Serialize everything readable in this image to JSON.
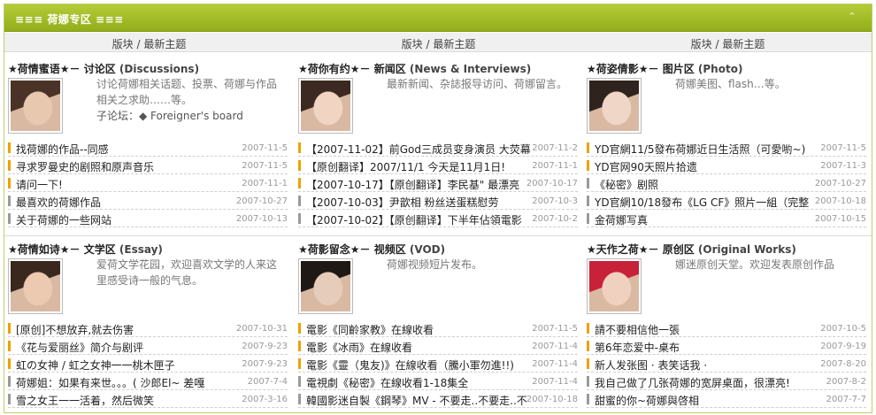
{
  "header": {
    "title": "≡≡≡ 荷娜专区 ≡≡≡",
    "collapse_icon": "chevron-up-icon",
    "collapse_glyph": "⌃"
  },
  "columns": [
    {
      "label": "版块  / 最新主题"
    },
    {
      "label": "版块  / 最新主题"
    },
    {
      "label": "版块  / 最新主题"
    }
  ],
  "forums": [
    {
      "title": "★荷情蜜语★－ 讨论区",
      "title_en": "(Discussions)",
      "desc": "讨论荷娜相关话题、投票、荷娜与作品相关之求助……等。",
      "sub_label": "子论坛：",
      "sub_item": "◆ Foreigner's board",
      "photo_colors": [
        "#e9c8b0",
        "#4a3326"
      ],
      "topics": [
        {
          "title": "找荷娜的作品--同感",
          "date": "2007-11-5",
          "gray": false
        },
        {
          "title": "寻求罗曼史的剧照和原声音乐",
          "date": "2007-11-5",
          "gray": false
        },
        {
          "title": "请问一下!",
          "date": "2007-11-1",
          "gray": false
        },
        {
          "title": "最喜欢的荷娜作品",
          "date": "2007-10-27",
          "gray": true
        },
        {
          "title": "关于荷娜的一些网站",
          "date": "2007-10-13",
          "gray": true
        }
      ]
    },
    {
      "title": "★荷你有约★－ 新闻区",
      "title_en": "(News & Interviews)",
      "desc": "最新新闻、杂誌报导访问、荷娜留言。",
      "sub_label": "",
      "sub_item": "",
      "photo_colors": [
        "#f1d4c2",
        "#3c2a22"
      ],
      "topics": [
        {
          "title": "【2007-11-02】前God三成员变身演员  大荧幕",
          "date": "2007-11-2",
          "gray": false
        },
        {
          "title": "【原创翻译】2007/11/1 今天是11月1日!",
          "date": "2007-11-1",
          "gray": false
        },
        {
          "title": "【2007-10-17】【原创翻译】李民基\" 最漂亮",
          "date": "2007-10-17",
          "gray": false
        },
        {
          "title": "【2007-10-03】尹歆相  粉丝送蛋糕慰劳",
          "date": "2007-10-3",
          "gray": true
        },
        {
          "title": "【2007-10-02】【原创翻译】下半年佔領電影",
          "date": "2007-10-2",
          "gray": true
        }
      ]
    },
    {
      "title": "★荷姿倩影★－ 图片区",
      "title_en": "(Photo)",
      "desc": "荷娜美图、flash…等。",
      "sub_label": "",
      "sub_item": "",
      "photo_colors": [
        "#efd6c6",
        "#2f231e"
      ],
      "topics": [
        {
          "title": "YD官網11/5發布荷娜近日生活照（可愛喲~)",
          "date": "2007-11-5",
          "gray": false
        },
        {
          "title": "YD官网90天照片拾遗",
          "date": "2007-11-3",
          "gray": false
        },
        {
          "title": "《秘密》剧照",
          "date": "2007-10-27",
          "gray": true
        },
        {
          "title": "YD官網10/18發布《LG CF》照片一組（完整",
          "date": "2007-10-18",
          "gray": true
        },
        {
          "title": "金荷娜写真",
          "date": "2007-10-15",
          "gray": true
        }
      ]
    },
    {
      "title": "★荷情如诗★－ 文学区",
      "title_en": "(Essay)",
      "desc": "爱荷文学花园，欢迎喜欢文学的人来这里感受诗一般的气息。",
      "sub_label": "",
      "sub_item": "",
      "photo_colors": [
        "#ecc9b1",
        "#3a271d"
      ],
      "topics": [
        {
          "title": "[原创]不想放弃,就去伤害",
          "date": "2007-10-31",
          "gray": false
        },
        {
          "title": "《花与爱丽丝》简介与剧评",
          "date": "2007-9-23",
          "gray": false
        },
        {
          "title": "虹の女神 / 虹之女神一一桃木匣子",
          "date": "2007-9-23",
          "gray": false
        },
        {
          "title": "荷娜姐：如果有来世。。。( 沙郎El~ 差嘎",
          "date": "2007-7-4",
          "gray": true
        },
        {
          "title": "雪之女王一一活着，然后微笑",
          "date": "2007-3-16",
          "gray": true
        }
      ]
    },
    {
      "title": "★荷影留念★－ 视频区",
      "title_en": "(VOD)",
      "desc": "荷娜视频短片发布。",
      "sub_label": "",
      "sub_item": "",
      "photo_colors": [
        "#e6ccba",
        "#1f1916"
      ],
      "topics": [
        {
          "title": "電影《同齡家教》在線收看",
          "date": "2007-11-5",
          "gray": false
        },
        {
          "title": "電影《冰雨》在線收看",
          "date": "2007-11-4",
          "gray": false
        },
        {
          "title": "電影《靈（鬼友)》在線收看（騰小軍勿進!!)",
          "date": "2007-11-4",
          "gray": false
        },
        {
          "title": "電視劇《秘密》在線收看1-18集全",
          "date": "2007-11-4",
          "gray": true
        },
        {
          "title": "韓國影迷自製《鋼琴》MV - 不要走..不要走..不",
          "date": "2007-10-18",
          "gray": true
        }
      ]
    },
    {
      "title": "★天作之荷★－ 原创区",
      "title_en": "(Original Works)",
      "desc": "娜迷原创天堂。欢迎发表原创作品",
      "sub_label": "",
      "sub_item": "",
      "photo_colors": [
        "#f0d1c0",
        "#c8213a"
      ],
      "topics": [
        {
          "title": "請不要相信他一張",
          "date": "2007-10-5",
          "gray": false
        },
        {
          "title": "第6年恋爱中-桌布",
          "date": "2007-9-19",
          "gray": false
        },
        {
          "title": "新人发张图 · 表笑话我 ·",
          "date": "2007-8-20",
          "gray": false
        },
        {
          "title": "我自己做了几张荷娜的宽屏桌面，很漂亮!",
          "date": "2007-8-2",
          "gray": true
        },
        {
          "title": "甜蜜的你~荷娜與啓相",
          "date": "2007-7-7",
          "gray": true
        }
      ]
    }
  ]
}
